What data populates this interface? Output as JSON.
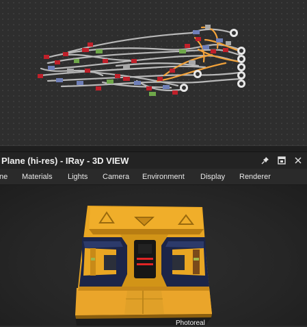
{
  "view": {
    "title": "Plane (hi-res) - IRay - 3D VIEW",
    "renderer_label": "Photoreal"
  },
  "menubar": {
    "items": [
      "ne",
      "Materials",
      "Lights",
      "Camera",
      "Environment",
      "Display",
      "Renderer"
    ]
  },
  "icons": {
    "pin": "pin-icon",
    "restore": "restore-window-icon",
    "close": "close-icon",
    "output_node": "output-node-icon"
  },
  "colors": {
    "graph_bg": "#2e2e2e",
    "link_gray": "#b9b9b9",
    "link_orange": "#f2a23a",
    "node_red": "#c0202a",
    "node_blue": "#6f7fb8",
    "node_green": "#6fa84a",
    "panel_yellow": "#e9a623",
    "panel_navy": "#1c2548",
    "led_red": "#e02424"
  }
}
